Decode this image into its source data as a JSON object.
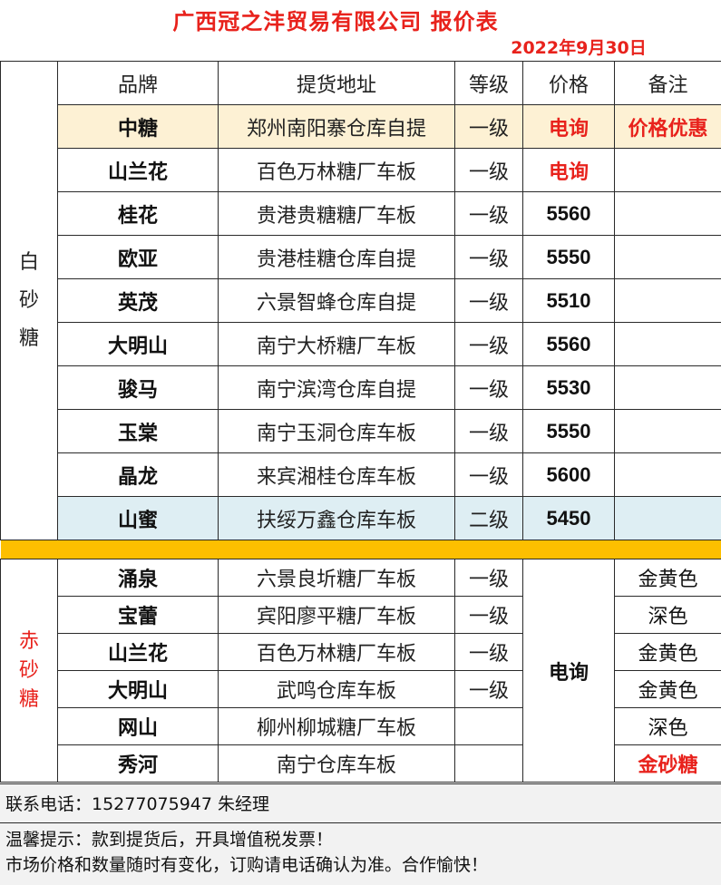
{
  "title": "广西冠之沣贸易有限公司  报价表",
  "date": "2022年9月30日",
  "headers": [
    "品牌",
    "提货地址",
    "等级",
    "价格",
    "备注"
  ],
  "white_sugar": {
    "category": [
      "白",
      "砂",
      "糖"
    ],
    "rows": [
      {
        "brand": "中糖",
        "address": "郑州南阳寨仓库自提",
        "grade": "一级",
        "price": "电询",
        "note": "价格优惠"
      },
      {
        "brand": "山兰花",
        "address": "百色万林糖厂车板",
        "grade": "一级",
        "price": "电询",
        "note": ""
      },
      {
        "brand": "桂花",
        "address": "贵港贵糖糖厂车板",
        "grade": "一级",
        "price": "5560",
        "note": ""
      },
      {
        "brand": "欧亚",
        "address": "贵港桂糖仓库自提",
        "grade": "一级",
        "price": "5550",
        "note": ""
      },
      {
        "brand": "英茂",
        "address": "六景智蜂仓库自提",
        "grade": "一级",
        "price": "5510",
        "note": ""
      },
      {
        "brand": "大明山",
        "address": "南宁大桥糖厂车板",
        "grade": "一级",
        "price": "5560",
        "note": ""
      },
      {
        "brand": "骏马",
        "address": "南宁滨湾仓库自提",
        "grade": "一级",
        "price": "5530",
        "note": ""
      },
      {
        "brand": "玉棠",
        "address": "南宁玉洞仓库车板",
        "grade": "一级",
        "price": "5550",
        "note": ""
      },
      {
        "brand": "晶龙",
        "address": "来宾湘桂仓库车板",
        "grade": "一级",
        "price": "5600",
        "note": ""
      },
      {
        "brand": "山蜜",
        "address": "扶绥万鑫仓库车板",
        "grade": "二级",
        "price": "5450",
        "note": ""
      }
    ]
  },
  "red_sugar": {
    "category": [
      "赤",
      "砂",
      "糖"
    ],
    "price": "电询",
    "rows": [
      {
        "brand": "涌泉",
        "address": "六景良圻糖厂车板",
        "grade": "一级",
        "note": "金黄色"
      },
      {
        "brand": "宝蕾",
        "address": "宾阳廖平糖厂车板",
        "grade": "一级",
        "note": "深色"
      },
      {
        "brand": "山兰花",
        "address": "百色万林糖厂车板",
        "grade": "一级",
        "note": "金黄色"
      },
      {
        "brand": "大明山",
        "address": "武鸣仓库车板",
        "grade": "一级",
        "note": "金黄色"
      },
      {
        "brand": "网山",
        "address": "柳州柳城糖厂车板",
        "grade": "",
        "note": "深色"
      },
      {
        "brand": "秀河",
        "address": "南宁仓库车板",
        "grade": "",
        "note": "金砂糖"
      }
    ]
  },
  "contact": "联系电话：15277075947  朱经理",
  "tips": [
    "温馨提示：款到提货后，开具增值税发票！",
    "市场价格和数量随时有变化，订购请电话确认为准。合作愉快！"
  ],
  "colors": {
    "accent_red": "#e8221c",
    "separator": "#fdbf00",
    "highlight_yellow": "#fdf1d4",
    "highlight_blue": "#deeef3"
  }
}
